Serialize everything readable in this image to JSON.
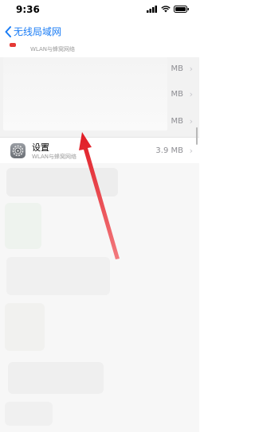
{
  "status_bar": {
    "time": "9:36"
  },
  "nav": {
    "back_label": "无线局域网"
  },
  "partial_row": {
    "subtitle": "WLAN与蜂窝网络"
  },
  "rows": [
    {
      "size": "MB"
    },
    {
      "size": "MB"
    },
    {
      "size": "MB"
    }
  ],
  "settings_app": {
    "name": "设置",
    "subtitle": "WLAN与蜂窝网络",
    "size": "3.9 MB"
  },
  "colors": {
    "accent": "#1a7cf5",
    "arrow": "#e8202a"
  }
}
